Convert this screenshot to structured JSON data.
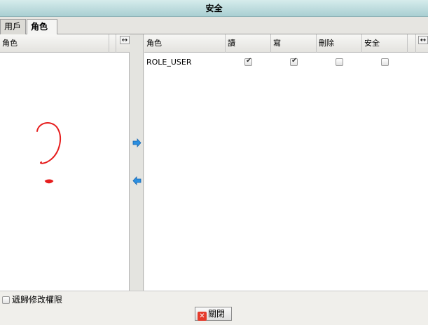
{
  "window": {
    "title": "安全"
  },
  "tabs": [
    {
      "label": "用戶"
    },
    {
      "label": "角色"
    }
  ],
  "left_panel": {
    "column_header": "角色"
  },
  "right_panel": {
    "columns": {
      "role": "角色",
      "read": "讀",
      "write": "寫",
      "delete": "刪除",
      "security": "安全"
    },
    "rows": [
      {
        "role": "ROLE_USER",
        "read": true,
        "write": true,
        "delete": false,
        "security": false
      }
    ]
  },
  "footer": {
    "recursive_label": "遞歸修改權限",
    "recursive_checked": false,
    "close_label": "關閉"
  },
  "colors": {
    "title_bar": "#a9cfd2",
    "arrow": "#2b8fe0",
    "annotation": "#e61e1e"
  },
  "icons": {
    "move_right": "arrow-right-icon",
    "move_left": "arrow-left-icon",
    "close": "close-x-icon",
    "column_resize": "resize-horizontal-icon"
  }
}
